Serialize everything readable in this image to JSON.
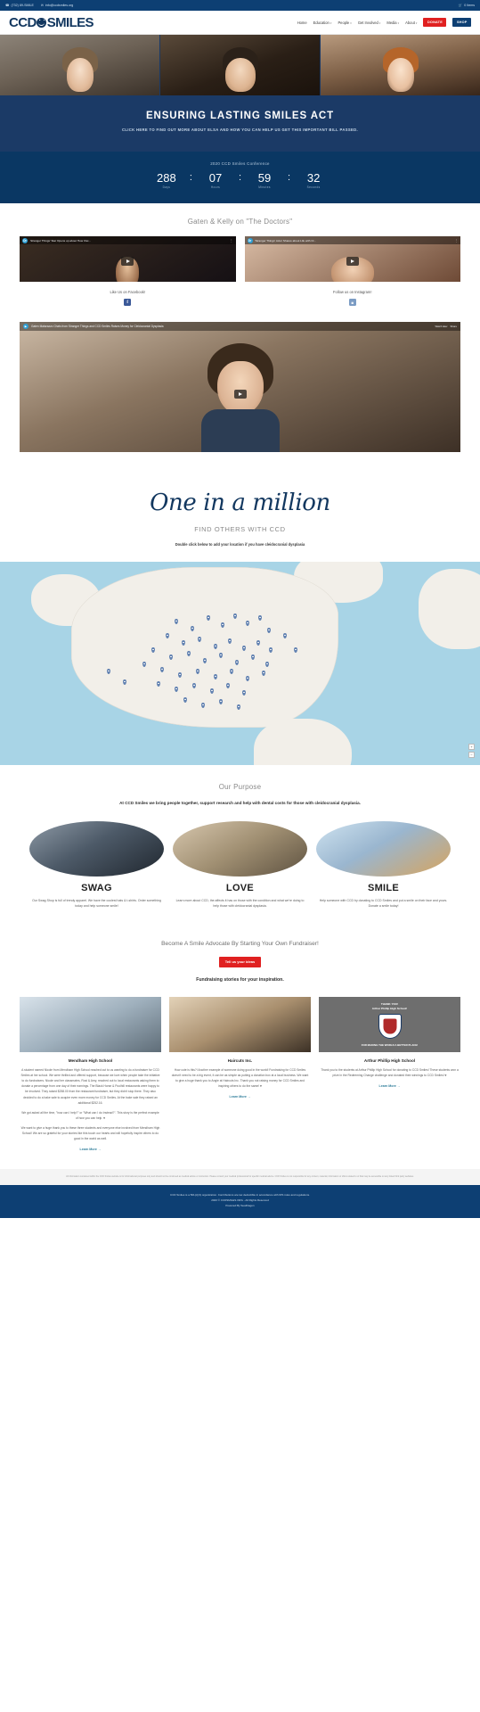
{
  "topbar": {
    "phone_icon": "phone-icon",
    "phone": "(732) 89-SMILE",
    "email_icon": "envelope-icon",
    "email": "info@ccdsmiles.org",
    "cart_icon": "cart-icon",
    "cart_label": "0 Items"
  },
  "header": {
    "logo_left": "CCD",
    "logo_right": "SMILES",
    "nav": [
      {
        "label": "Home",
        "has_caret": false
      },
      {
        "label": "Education",
        "has_caret": true
      },
      {
        "label": "People",
        "has_caret": true
      },
      {
        "label": "Get Involved",
        "has_caret": true
      },
      {
        "label": "Media",
        "has_caret": true
      },
      {
        "label": "About",
        "has_caret": true
      }
    ],
    "donate_label": "DONATE",
    "shop_label": "SHOP"
  },
  "hero": {
    "title": "ENSURING LASTING SMILES ACT",
    "subtitle": "CLICK HERE TO FIND OUT MORE ABOUT ELSA AND HOW YOU CAN HELP US GET THIS IMPORTANT BILL PASSED."
  },
  "countdown": {
    "label": "2020 CCD Smiles Conference",
    "units": [
      {
        "value": "288",
        "caption": "Days"
      },
      {
        "value": "07",
        "caption": "Hours"
      },
      {
        "value": "59",
        "caption": "Minutes"
      },
      {
        "value": "32",
        "caption": "Seconds"
      }
    ],
    "separator": ":"
  },
  "videos": {
    "section_title": "Gaten & Kelly on \"The Doctors\"",
    "items": [
      {
        "channel_badge": "Dr",
        "title": "'Stranger Things' Star Opens up about How Clei...",
        "menu_icon": "kebab-menu-icon",
        "play_icon": "play-icon"
      },
      {
        "channel_badge": "Dr",
        "title": "'Stranger Things' Actor Shares about Life with Cl...",
        "menu_icon": "kebab-menu-icon",
        "play_icon": "play-icon"
      }
    ],
    "social": [
      {
        "label": "Like Us on Facebook!",
        "icon": "facebook-icon",
        "glyph": "f"
      },
      {
        "label": "Follow us on Instagram!",
        "icon": "instagram-icon",
        "glyph": "◙"
      }
    ]
  },
  "feature_video": {
    "title": "Gaten Matarazzo Chats from Stranger Things and CCD Smiles Raises Money for Cleidocranial Dysplasia",
    "watch_later": "Watch later",
    "share": "Share",
    "play_icon": "play-icon"
  },
  "one_in_a_million": {
    "script_title": "One in a million",
    "subtitle": "FIND OTHERS WITH CCD",
    "note": "Double click below to add your location if you have cleidocranial dysplasia"
  },
  "map": {
    "zoom_in_icon": "plus-icon",
    "zoom_out_icon": "minus-icon"
  },
  "purpose": {
    "title": "Our Purpose",
    "lead": "At CCD Smiles we bring people together, support research and help with dental costs for those with cleidocranial dysplasia.",
    "cards": [
      {
        "title": "SWAG",
        "body": "Our Swag Shop is full of trendy apparel. We have the coolest hats & t-shirts. Order something today and help someone smile!"
      },
      {
        "title": "LOVE",
        "body": "Learn more about CCD, the affects it has on those with the condition and what we're doing to help those with cleidocranial dysplasia."
      },
      {
        "title": "SMILE",
        "body": "Help someone with CCD by donating to CCD Smiles and put a smile on their face and yours. Donate a smile today!"
      }
    ]
  },
  "fundraiser": {
    "heading": "Become A Smile Advocate By Starting Your Own Fundraiser!",
    "button_label": "Tell us your ideas",
    "subheading": "Fundraising stories for your inspiration.",
    "stories": [
      {
        "title": "Mendham High School",
        "paragraphs": [
          "A student named Nicole from Mendham High School reached out to us wanting to do a fundraiser for CCD Smiles at her school. We were thrilled and offered support, because we love when people take the initiative to do fundraisers. Nicole and her classmates, Rosi & Amy, reached out to local restaurants asking them to donate a percentage from one day of their earnings. The Black Horse & Poolhill restaurants were happy to be involved. They raised $258.00 from the restaurant fundraiser, but they didn't stop there. They also decided to do a bake sale to acquire even more money for CCD Smiles. At the bake sale they raised an additional $252.16.",
          "We got asked all the time, \"how can I help?\" or \"What can I do Instead?\". This story is the perfect example of how you can help. ♥",
          "We want to give a huge thank you to these three students and everyone else involved from Mendham High School! We are so grateful for your stories like this touch our hearts and will hopefully inspire others to do good in the world as well."
        ],
        "learn_more": "Learn More →"
      },
      {
        "title": "Haircuts Inc.",
        "paragraphs": [
          "How cute is this?! Another example of someone doing good in the world! Fundraising for CCD Smiles doesn't need to be a big event, it can be as simple as putting a donation box at a local business. We want to give a huge thank you to Angie at Haircuts Inc. Thank you not raising money for CCD Smiles and inspiring others to do the same! ♥"
        ],
        "learn_more": "Learn More →"
      },
      {
        "title": "Arthur Phillip High School",
        "paragraphs": [
          "Thank you to the students at Arthur Phillip High School for donating to CCD Smiles! These students won a prize in the Redeeming Change challenge and donated their winnings to CCD Smiles! ♥"
        ],
        "learn_more": "Learn More →",
        "image_top_text": "THANK YOU!",
        "image_school": "Arthur Phillip High School!",
        "image_bottom_text": "FOR MAKING THE WORLD A BETTER PLACE!"
      }
    ]
  },
  "footer": {
    "disclaimer": "All information contained within the CCD Smiles website is for informational purposes only and should not be construed as medical advice or instruction. Please consult your medical professional for specific medical advice. CCD Smiles is not responsible for any content, material, information or offers related to or that may be accessible on any linked third party websites.",
    "copyright": "CCD Smiles is a 501(c)(3) organization. Contributions are tax deductible in accordance with IRS rules and regulations.",
    "rights": "2020 © CCDSMILES.ORG - All Rights Reserved",
    "credit": "Powered By SeaDragon"
  }
}
